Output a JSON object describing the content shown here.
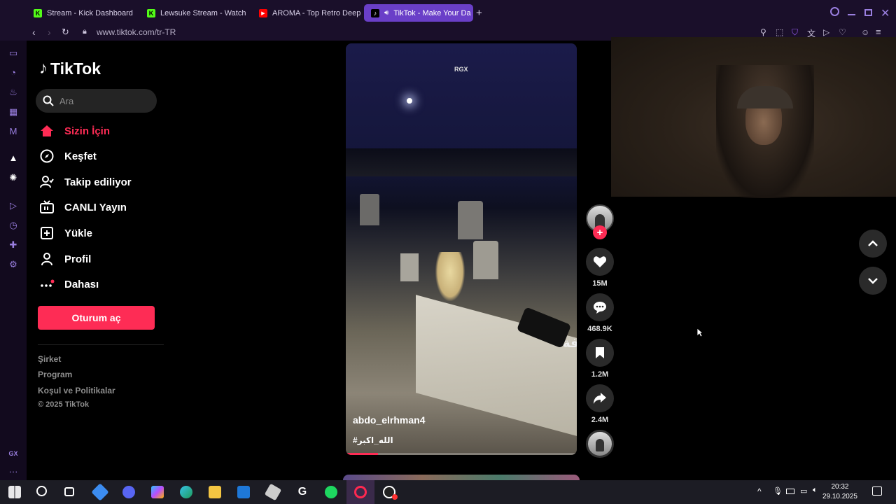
{
  "browser": {
    "tabs": [
      {
        "title": "Stream - Kick Dashboard",
        "icon": "kick-icon",
        "active": false
      },
      {
        "title": "Lewsuke Stream - Watch",
        "icon": "kick-icon",
        "active": false
      },
      {
        "title": "AROMA - Top Retro Deep",
        "icon": "youtube-icon",
        "active": false
      },
      {
        "title": "TikTok - Make Your Da",
        "icon": "tiktok-icon",
        "active": true
      }
    ],
    "url": "www.tiktok.com/tr-TR"
  },
  "tiktok": {
    "logo_text": "TikTok",
    "search_placeholder": "Ara",
    "nav": [
      {
        "label": "Sizin İçin",
        "icon": "home-icon",
        "active": true
      },
      {
        "label": "Keşfet",
        "icon": "compass-icon",
        "active": false
      },
      {
        "label": "Takip ediliyor",
        "icon": "following-icon",
        "active": false
      },
      {
        "label": "CANLI Yayın",
        "icon": "live-tv-icon",
        "active": false
      },
      {
        "label": "Yükle",
        "icon": "upload-icon",
        "active": false
      },
      {
        "label": "Profil",
        "icon": "profile-icon",
        "active": false
      },
      {
        "label": "Dahası",
        "icon": "more-icon",
        "active": false
      }
    ],
    "login_label": "Oturum aç",
    "footer": {
      "company": "Şirket",
      "program": "Program",
      "terms": "Koşul ve Politikalar",
      "copyright": "© 2025 TikTok"
    }
  },
  "video": {
    "watermark": "RGX",
    "username": "abdo_elrhman4",
    "hashtag": "#الله_اكبر",
    "overlay_text": "فة",
    "progress_percent": 14
  },
  "actions": {
    "likes": "15M",
    "comments": "468.9K",
    "saves": "1.2M",
    "shares": "2.4M"
  },
  "opera_sidebar_label": "GX",
  "taskbar": {
    "time": "20:32",
    "date": "29.10.2025"
  },
  "colors": {
    "tiktok_red": "#fe2c55",
    "opera_purple": "#6a3fc8"
  }
}
